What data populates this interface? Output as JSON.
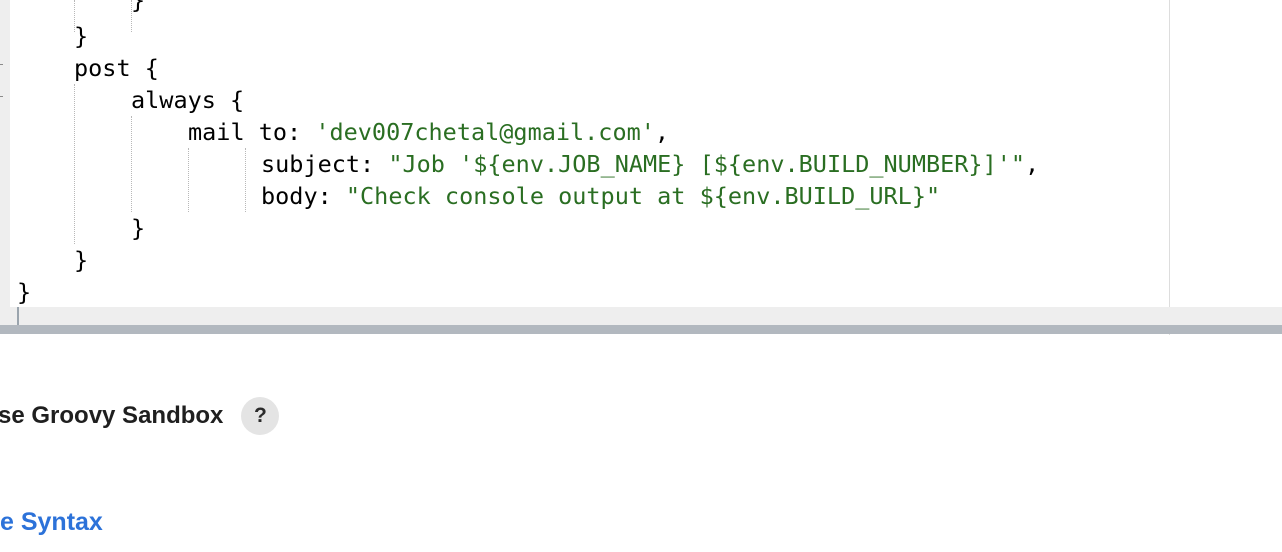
{
  "editor": {
    "lines": [
      {
        "parts": [
          {
            "t": "}",
            "k": "plain"
          }
        ]
      },
      {
        "parts": [
          {
            "t": "}",
            "k": "plain"
          }
        ]
      },
      {
        "parts": [
          {
            "t": "post {",
            "k": "plain"
          }
        ]
      },
      {
        "parts": [
          {
            "t": "always {",
            "k": "plain"
          }
        ]
      },
      {
        "parts": [
          {
            "t": "mail to: ",
            "k": "plain"
          },
          {
            "t": "'dev007chetal@gmail.com'",
            "k": "str"
          },
          {
            "t": ",",
            "k": "plain"
          }
        ]
      },
      {
        "parts": [
          {
            "t": "subject: ",
            "k": "plain"
          },
          {
            "t": "\"Job '${env.JOB_NAME} [${env.BUILD_NUMBER}]'\"",
            "k": "str"
          },
          {
            "t": ",",
            "k": "plain"
          }
        ]
      },
      {
        "parts": [
          {
            "t": "body: ",
            "k": "plain"
          },
          {
            "t": "\"Check console output at ${env.BUILD_URL}\"",
            "k": "str"
          }
        ]
      },
      {
        "parts": [
          {
            "t": "}",
            "k": "plain"
          }
        ]
      },
      {
        "parts": [
          {
            "t": "}",
            "k": "plain"
          }
        ]
      },
      {
        "parts": [
          {
            "t": "}",
            "k": "plain"
          }
        ]
      }
    ]
  },
  "form": {
    "sandbox_label": "se Groovy Sandbox",
    "help_label": "?",
    "syntax_link": "e Syntax"
  },
  "colors": {
    "string": "#2a6e22",
    "link": "#2c72d9"
  }
}
